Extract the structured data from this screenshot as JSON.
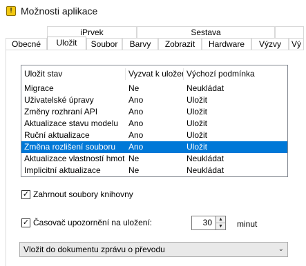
{
  "window": {
    "title": "Možnosti aplikace",
    "icon": "app-icon"
  },
  "tabs_top": [
    "iPrvek",
    "Sestava"
  ],
  "tabs_bottom": [
    "Obecné",
    "Uložit",
    "Soubor",
    "Barvy",
    "Zobrazit",
    "Hardware",
    "Výzvy",
    "Vý"
  ],
  "active_tab": "Uložit",
  "list": {
    "columns": [
      "Uložit stav",
      "Vyzvat k uložení",
      "Výchozí podmínka"
    ],
    "rows": [
      [
        "Migrace",
        "Ne",
        "Neukládat"
      ],
      [
        "Uživatelské úpravy",
        "Ano",
        "Uložit"
      ],
      [
        "Změny rozhraní API",
        "Ano",
        "Uložit"
      ],
      [
        "Aktualizace stavu modelu",
        "Ano",
        "Uložit"
      ],
      [
        "Ruční aktualizace",
        "Ano",
        "Uložit"
      ],
      [
        "Změna rozlišení souboru",
        "Ano",
        "Uložit"
      ],
      [
        "Aktualizace vlastností hmotnosti",
        "Ne",
        "Neukládat"
      ],
      [
        "Implicitní aktualizace",
        "Ne",
        "Neukládat"
      ]
    ],
    "selected_index": 5,
    "selected_color": "#0078d7"
  },
  "include_libraries": {
    "label": "Zahrnout soubory knihovny",
    "checked": true
  },
  "timer": {
    "label": "Časovač upozornění na uložení:",
    "checked": true,
    "value": "30",
    "unit": "minut"
  },
  "dropdown": {
    "value": "Vložit do dokumentu zprávu o převodu"
  },
  "glyphs": {
    "check": "✓",
    "up": "▲",
    "down": "▼",
    "chevron": "⌄"
  }
}
